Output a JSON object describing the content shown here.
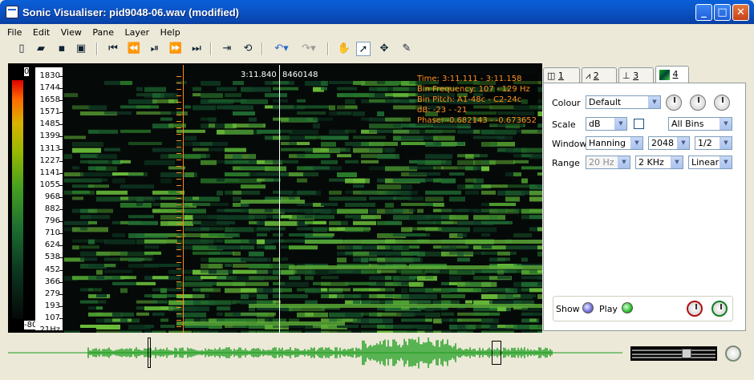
{
  "window": {
    "title": "Sonic Visualiser: pid9048-06.wav (modified)"
  },
  "menu": [
    "File",
    "Edit",
    "View",
    "Pane",
    "Layer",
    "Help"
  ],
  "colour_scale": {
    "top": "0",
    "bottom": "-80"
  },
  "freq_labels": [
    "1830",
    "1744",
    "1658",
    "1571",
    "1485",
    "1399",
    "1313",
    "1227",
    "1141",
    "1055",
    "968",
    "882",
    "796",
    "710",
    "624",
    "538",
    "452",
    "366",
    "279",
    "193",
    "107",
    "21Hz"
  ],
  "cursor": {
    "time": "3:11.840",
    "frame": "8460148"
  },
  "info": {
    "time": "Time: 3:11.111 - 3:11.158",
    "bin_frequency": "Bin Frequency: 107 - 129 Hz",
    "bin_pitch": "Bin Pitch: A1-48c - C2-24c",
    "db": "dB: -23 - -21",
    "phase": "Phase: -0.682143 - -0.673652"
  },
  "tabs": [
    {
      "label": "1",
      "icon": "pane-icon"
    },
    {
      "label": "2",
      "icon": "waveform-icon"
    },
    {
      "label": "3",
      "icon": "ruler-icon"
    },
    {
      "label": "4",
      "icon": "spectrogram-icon"
    }
  ],
  "props": {
    "colour_label": "Colour",
    "colour_value": "Default",
    "scale_label": "Scale",
    "scale_value": "dB",
    "bins_value": "All Bins",
    "window_label": "Window",
    "window_value": "Hanning",
    "window_size": "2048",
    "overlap": "1/2",
    "range_label": "Range",
    "range_min": "20 Hz",
    "range_max": "2 KHz",
    "range_type": "Linear",
    "show_label": "Show",
    "play_label": "Play"
  },
  "colors": {
    "accent_orange": "#ff8a1f",
    "wave_green": "#1a9c1a"
  }
}
